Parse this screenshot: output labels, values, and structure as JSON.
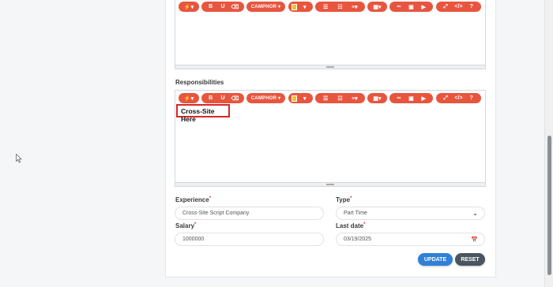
{
  "toolbar": {
    "magic_label": "⚡▾",
    "bold_label": "B",
    "underline_label": "U",
    "eraser_label": "⌫",
    "font_label": "CAMPHOR ▾",
    "color_caret": "▾",
    "ul_label": "☰",
    "ol_label": "☷",
    "align_label": "≡▾",
    "table_label": "▦▾",
    "link_label": "∞",
    "image_label": "▣",
    "video_label": "▶",
    "fullscreen_label": "⤢",
    "code_label": "</>",
    "help_label": "?"
  },
  "responsibilities": {
    "label": "Responsibilities",
    "content": "Cross-Site Here"
  },
  "experience": {
    "label": "Experience",
    "required": "*",
    "value": "Cross-Site Script Company"
  },
  "type": {
    "label": "Type",
    "required": "*",
    "value": "Part Time",
    "caret": "⌄"
  },
  "salary": {
    "label": "Salary",
    "required": "*",
    "value": "1000000"
  },
  "last_date": {
    "label": "Last date",
    "required": "*",
    "value": "03/19/2025",
    "icon": "📅"
  },
  "actions": {
    "update_label": "UPDATE",
    "reset_label": "RESET"
  },
  "colors": {
    "toolbar": "#e8553f",
    "update": "#2f80d8",
    "reset": "#4a5560",
    "highlight": "#d62828"
  }
}
